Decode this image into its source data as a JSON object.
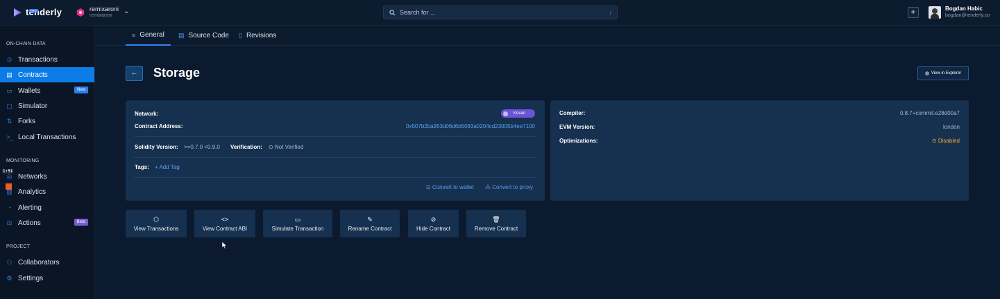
{
  "header": {
    "logo_text": "tenderly",
    "logo_badge": "PRO",
    "project_name": "remixaroni",
    "project_owner": "remixaroni",
    "search_placeholder": "Search for ...",
    "search_shortcut": "/",
    "user_name": "Bogdan Habic",
    "user_email": "bogdan@tenderly.co"
  },
  "sidebar": {
    "section_onchain": "ON-CHAIN DATA",
    "section_monitoring": "MONITORING",
    "section_project": "PROJECT",
    "items": {
      "transactions": "Transactions",
      "contracts": "Contracts",
      "wallets": "Wallets",
      "wallets_badge": "New",
      "simulator": "Simulator",
      "forks": "Forks",
      "local_transactions": "Local Transactions",
      "networks": "Networks",
      "analytics": "Analytics",
      "alerting": "Alerting",
      "actions": "Actions",
      "actions_badge": "Beta",
      "collaborators": "Collaborators",
      "settings": "Settings"
    },
    "timer": "1:51"
  },
  "tabs": {
    "general": "General",
    "source_code": "Source Code",
    "revisions": "Revisions"
  },
  "page": {
    "title": "Storage",
    "view_in_explorer": "View in Explorer"
  },
  "contract_info": {
    "network_label": "Network:",
    "network_value": "Kovan",
    "address_label": "Contract Address:",
    "address_value": "0x507b2ba953d06d6b5083a0204cd23005b4ee7100",
    "solidity_label": "Solidity Version:",
    "solidity_value": ">=0.7.0 <0.9.0",
    "verification_label": "Verification:",
    "verification_value": "Not Verified",
    "tags_label": "Tags:",
    "add_tag": "+ Add Tag",
    "convert_wallet": "Convert to wallet",
    "convert_proxy": "Convert to proxy"
  },
  "compiler_info": {
    "compiler_label": "Compiler:",
    "compiler_value": "0.8.7+commit.e28d00a7",
    "evm_label": "EVM Version:",
    "evm_value": "london",
    "optimizations_label": "Optimizations:",
    "optimizations_value": "Disabled"
  },
  "actions": {
    "view_transactions": "View Transactions",
    "view_abi": "View Contract ABI",
    "simulate": "Simulate Transaction",
    "rename": "Rename Contract",
    "hide": "Hide Contract",
    "remove": "Remove Contract"
  },
  "colors": {
    "background": "#0b1a2e",
    "card": "#16304f",
    "accent": "#0c7ce6",
    "network_badge": "#6a55d6",
    "warning": "#f0a93a"
  }
}
